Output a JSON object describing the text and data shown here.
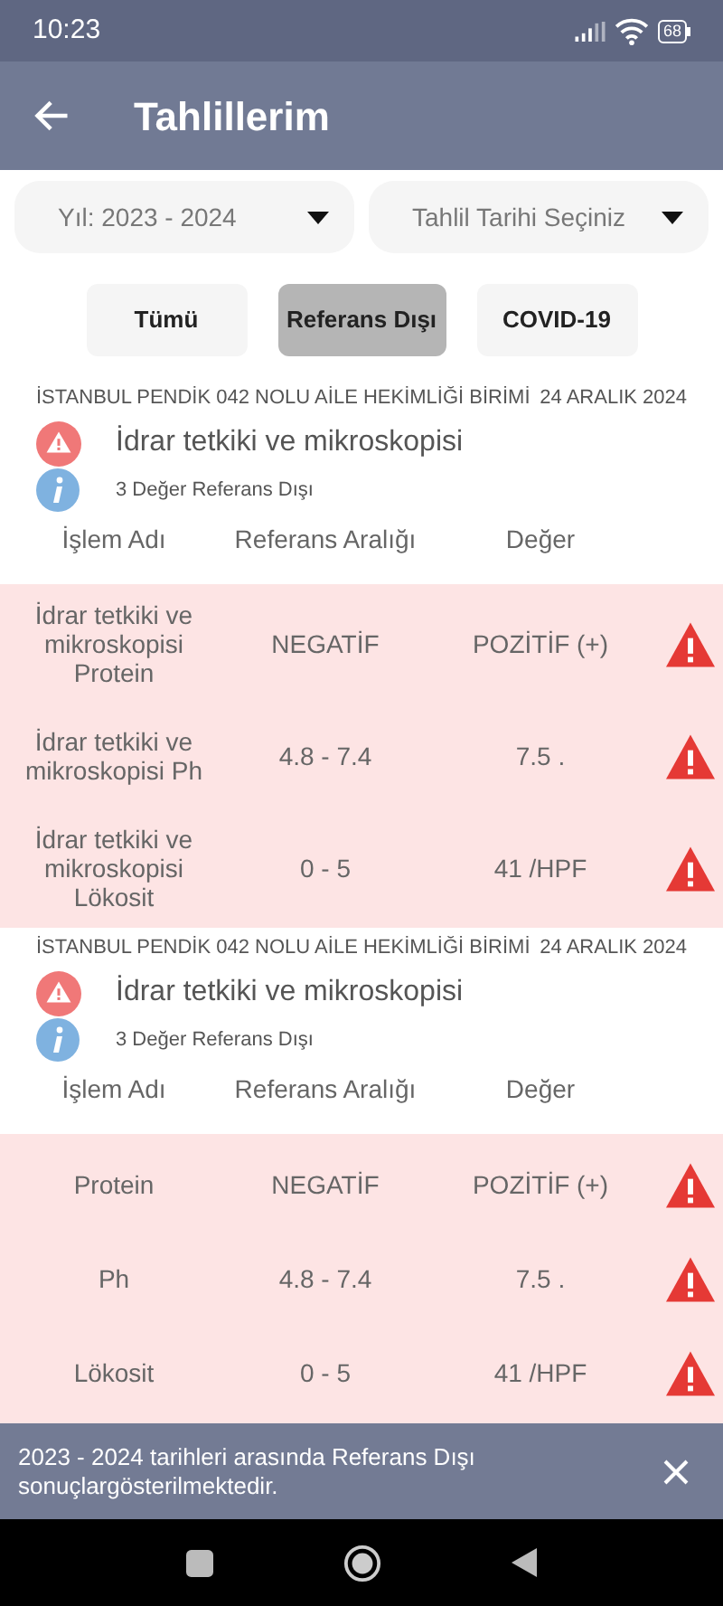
{
  "status_bar": {
    "time": "10:23",
    "battery": "68"
  },
  "app_bar": {
    "title": "Tahlillerim"
  },
  "filters": [
    {
      "value": "Yıl: 2023 - 2024"
    },
    {
      "value": "Tahlil Tarihi Seçiniz"
    }
  ],
  "chips": [
    {
      "label": "Tümü",
      "selected": false
    },
    {
      "label": "Referans Dışı",
      "selected": true
    },
    {
      "label": "COVID-19",
      "selected": false
    }
  ],
  "groups": [
    {
      "institution": "İSTANBUL PENDİK 042 NOLU AİLE HEKİMLİĞİ BİRİMİ",
      "date": "24 ARALIK 2024",
      "title": "İdrar tetkiki ve mikroskopisi",
      "summary": "3 Değer Referans Dışı",
      "columns": [
        "İşlem Adı",
        "Referans Aralığı",
        "Değer"
      ],
      "rows": [
        {
          "name": "İdrar tetkiki ve mikroskopisi Protein",
          "range": "NEGATİF",
          "value": "POZİTİF (+)"
        },
        {
          "name": "İdrar tetkiki ve mikroskopisi Ph",
          "range": "4.8 - 7.4",
          "value": "7.5 ."
        },
        {
          "name": "İdrar tetkiki ve mikroskopisi Lökosit",
          "range": "0 - 5",
          "value": "41 /HPF"
        }
      ]
    },
    {
      "institution": "İSTANBUL PENDİK 042 NOLU AİLE HEKİMLİĞİ BİRİMİ",
      "date": "24 ARALIK 2024",
      "title": "İdrar tetkiki ve mikroskopisi",
      "summary": "3 Değer Referans Dışı",
      "columns": [
        "İşlem Adı",
        "Referans Aralığı",
        "Değer"
      ],
      "rows": [
        {
          "name": "Protein",
          "range": "NEGATİF",
          "value": "POZİTİF (+)"
        },
        {
          "name": "Ph",
          "range": "4.8 - 7.4",
          "value": "7.5 ."
        },
        {
          "name": "Lökosit",
          "range": "0 - 5",
          "value": "41 /HPF"
        }
      ]
    }
  ],
  "snackbar": {
    "message": "2023 - 2024 tarihleri arasında Referans Dışı sonuçlargösterilmektedir."
  }
}
